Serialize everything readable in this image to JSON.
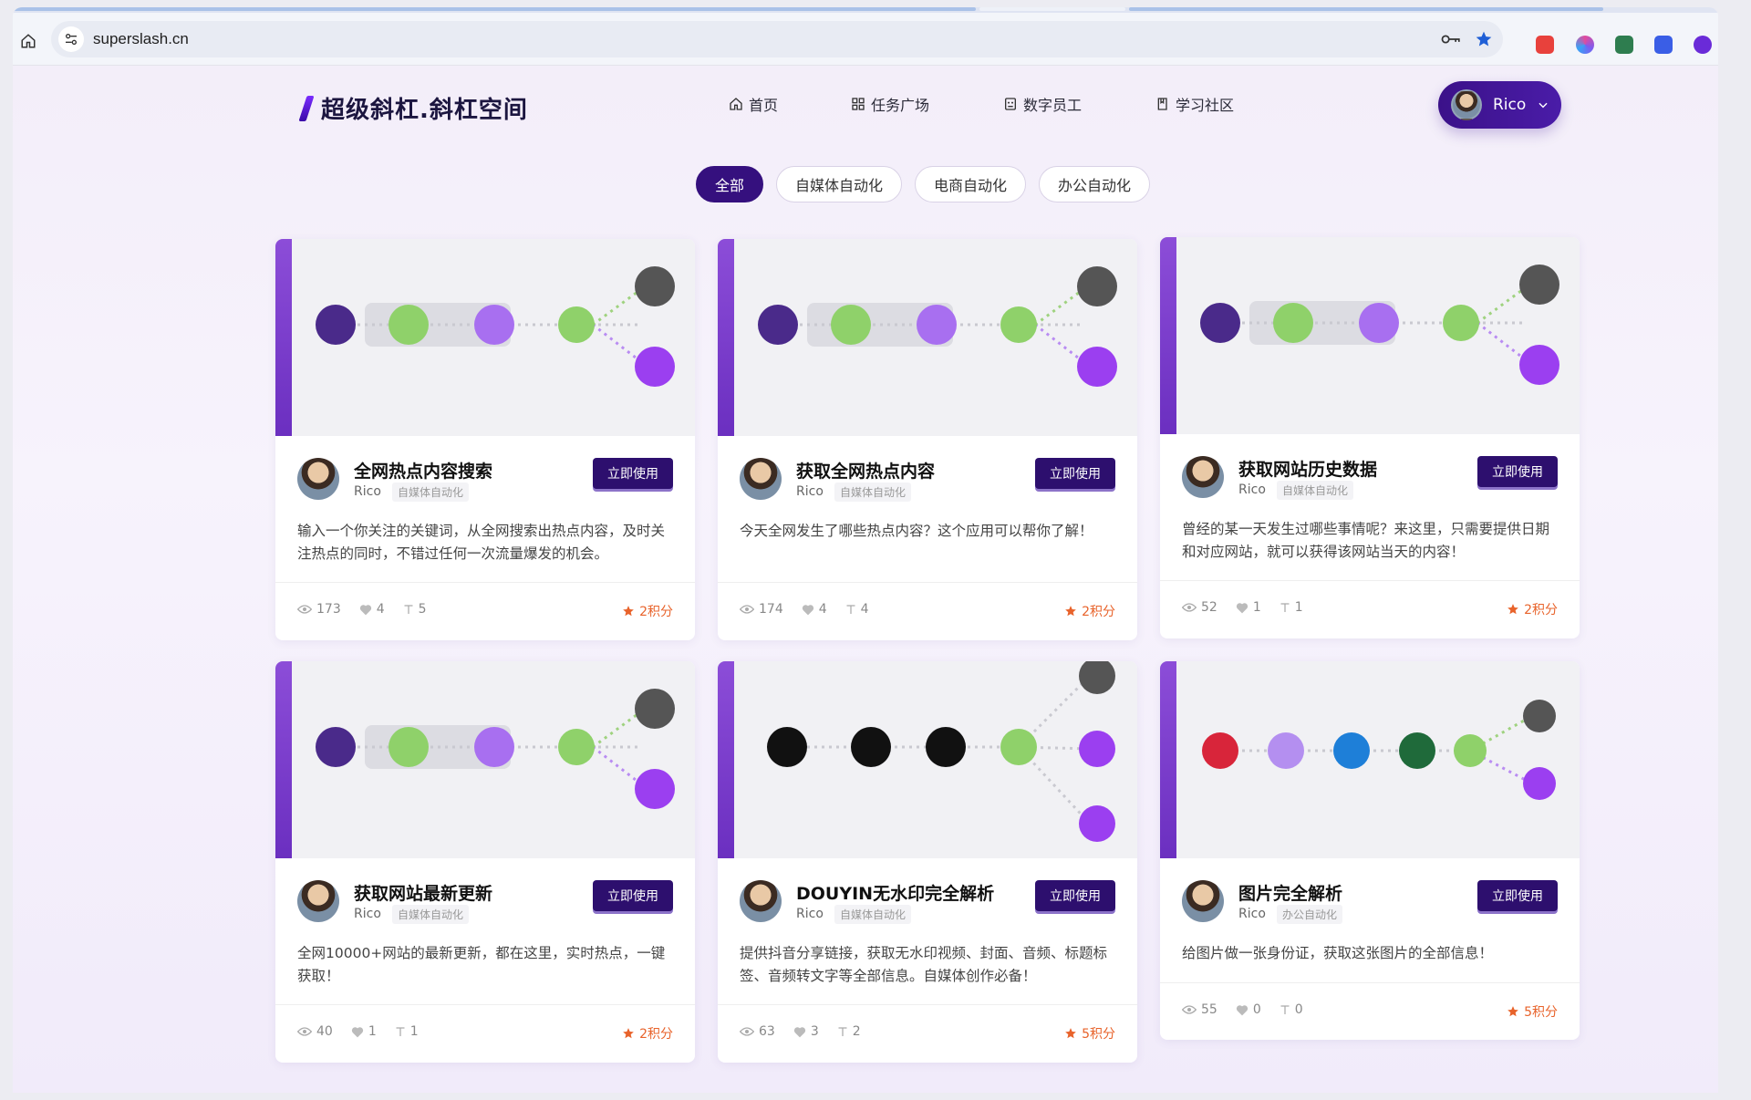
{
  "browser": {
    "url": "superslash.cn"
  },
  "header": {
    "logo_text": "超级斜杠.斜杠空间",
    "nav": [
      {
        "label": "首页",
        "icon": "home-icon"
      },
      {
        "label": "任务广场",
        "icon": "grid-icon"
      },
      {
        "label": "数字员工",
        "icon": "robot-icon"
      },
      {
        "label": "学习社区",
        "icon": "book-icon"
      }
    ],
    "user_name": "Rico"
  },
  "filters": [
    {
      "label": "全部",
      "active": true
    },
    {
      "label": "自媒体自动化",
      "active": false
    },
    {
      "label": "电商自动化",
      "active": false
    },
    {
      "label": "办公自动化",
      "active": false
    }
  ],
  "cards": [
    {
      "title": "全网热点内容搜索",
      "author": "Rico",
      "tag": "自媒体自动化",
      "button": "立即使用",
      "desc": "输入一个你关注的关键词，从全网搜索出热点内容，及时关注热点的同时，不错过任何一次流量爆发的机会。",
      "views": "173",
      "likes": "4",
      "uses": "5",
      "points": "2积分"
    },
    {
      "title": "获取全网热点内容",
      "author": "Rico",
      "tag": "自媒体自动化",
      "button": "立即使用",
      "desc": "今天全网发生了哪些热点内容？这个应用可以帮你了解！",
      "views": "174",
      "likes": "4",
      "uses": "4",
      "points": "2积分"
    },
    {
      "title": "获取网站历史数据",
      "author": "Rico",
      "tag": "自媒体自动化",
      "button": "立即使用",
      "desc": "曾经的某一天发生过哪些事情呢？来这里，只需要提供日期和对应网站，就可以获得该网站当天的内容！",
      "views": "52",
      "likes": "1",
      "uses": "1",
      "points": "2积分"
    },
    {
      "title": "获取网站最新更新",
      "author": "Rico",
      "tag": "自媒体自动化",
      "button": "立即使用",
      "desc": "全网10000+网站的最新更新，都在这里，实时热点，一键获取！",
      "views": "40",
      "likes": "1",
      "uses": "1",
      "points": "2积分"
    },
    {
      "title": "DOUYIN无水印完全解析",
      "author": "Rico",
      "tag": "自媒体自动化",
      "button": "立即使用",
      "desc": "提供抖音分享链接，获取无水印视频、封面、音频、标题标签、音频转文字等全部信息。自媒体创作必备！",
      "views": "63",
      "likes": "3",
      "uses": "2",
      "points": "5积分"
    },
    {
      "title": "图片完全解析",
      "author": "Rico",
      "tag": "办公自动化",
      "button": "立即使用",
      "desc": "给图片做一张身份证，获取这张图片的全部信息！",
      "views": "55",
      "likes": "0",
      "uses": "0",
      "points": "5积分"
    }
  ],
  "colors": {
    "primary": "#35107e",
    "accent": "#e8632b",
    "node_green": "#8fd16a",
    "node_purple": "#a86ff0",
    "node_dark_purple": "#4a2a8a"
  }
}
